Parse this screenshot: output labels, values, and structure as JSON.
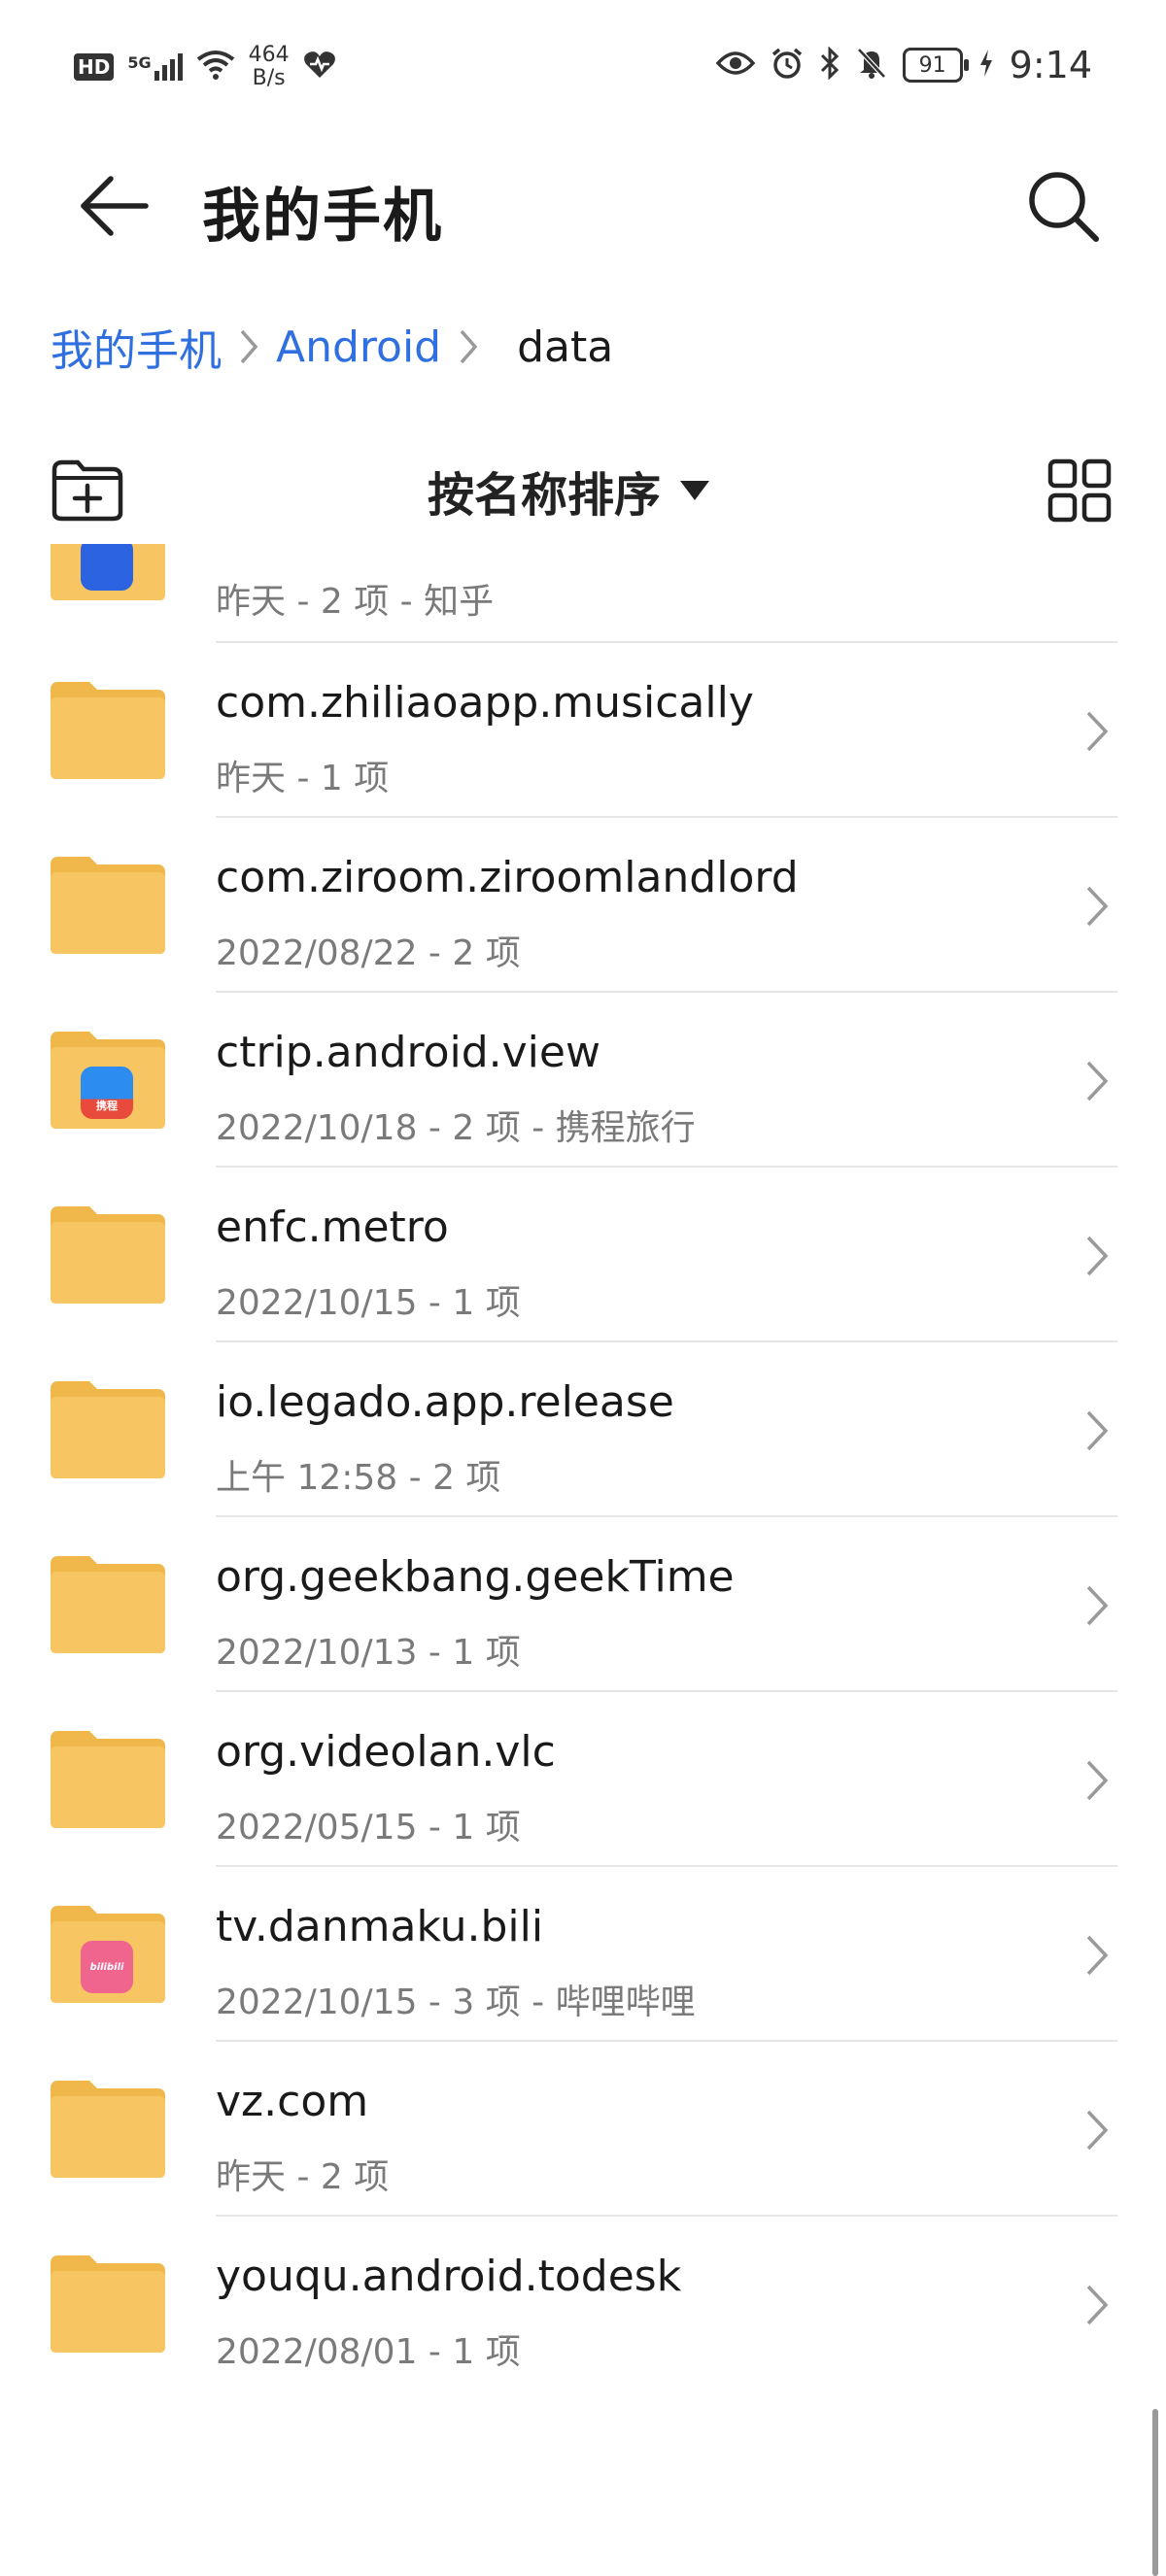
{
  "status_bar": {
    "hd": "HD",
    "signal": "5G",
    "net_speed_value": "464",
    "net_speed_unit": "B/s",
    "battery": "91",
    "time": "9:14"
  },
  "header": {
    "title": "我的手机"
  },
  "breadcrumb": {
    "items": [
      "我的手机",
      "Android"
    ],
    "current": "data"
  },
  "toolbar": {
    "sort_label": "按名称排序"
  },
  "partial_row": {
    "meta": "昨天 - 2 项 - 知乎"
  },
  "files": [
    {
      "name": "com.zhiliaoapp.musically",
      "meta": "昨天 - 1 项"
    },
    {
      "name": "com.ziroom.ziroomlandlord",
      "meta": "2022/08/22 - 2 项"
    },
    {
      "name": "ctrip.android.view",
      "meta": "2022/10/18 - 2 项 - 携程旅行"
    },
    {
      "name": "enfc.metro",
      "meta": "2022/10/15 - 1 项"
    },
    {
      "name": "io.legado.app.release",
      "meta": "上午 12:58  - 2 项"
    },
    {
      "name": "org.geekbang.geekTime",
      "meta": "2022/10/13 - 1 项"
    },
    {
      "name": "org.videolan.vlc",
      "meta": "2022/05/15 - 1 项"
    },
    {
      "name": "tv.danmaku.bili",
      "meta": "2022/10/15 - 3 项 - 哔哩哔哩"
    },
    {
      "name": "vz.com",
      "meta": "昨天 - 2 项"
    },
    {
      "name": "youqu.android.todesk",
      "meta": "2022/08/01 - 1 项"
    }
  ],
  "badges": {
    "ctrip": "携程",
    "bili": "bilibili"
  },
  "colors": {
    "accent": "#2f6fdf",
    "folder": "#f7c663",
    "folder_tab": "#f0b84b"
  }
}
